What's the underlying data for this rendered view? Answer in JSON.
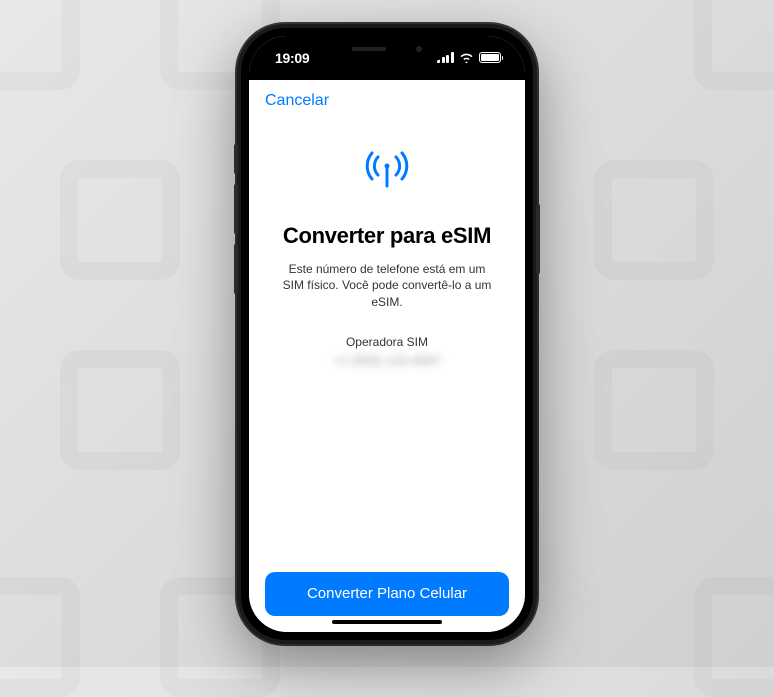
{
  "status_bar": {
    "time": "19:09"
  },
  "nav": {
    "cancel_label": "Cancelar"
  },
  "content": {
    "title": "Converter para eSIM",
    "description": "Este número de telefone está em um SIM físico. Você pode convertê-lo a um eSIM.",
    "carrier_label": "Operadora SIM",
    "phone_number_redacted": "+1 (555) 123-4567"
  },
  "actions": {
    "convert_button_label": "Converter Plano Celular"
  },
  "colors": {
    "accent": "#007AFF"
  }
}
